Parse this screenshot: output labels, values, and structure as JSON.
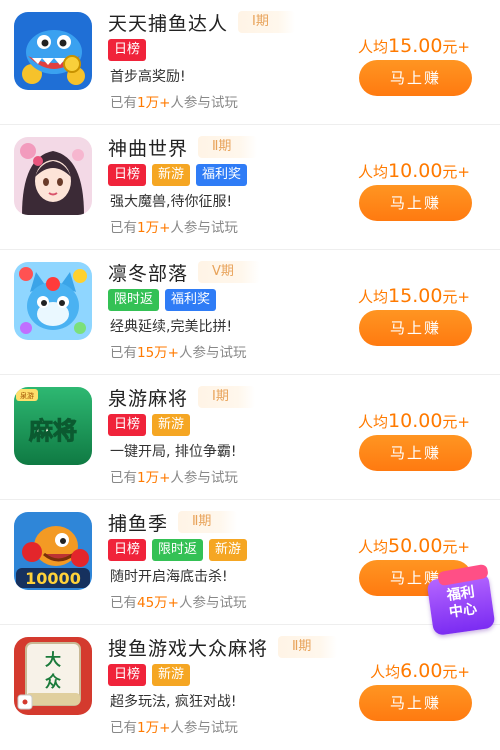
{
  "colors": {
    "accent": "#ff7a00",
    "tag_red": "#f0233a",
    "tag_orange": "#f5a623",
    "tag_blue": "#2f7cf6",
    "tag_green": "#34c155"
  },
  "games": [
    {
      "title": "天天捕鱼达人",
      "period": "Ⅰ期",
      "tags": [
        {
          "text": "日榜",
          "color": "red"
        }
      ],
      "desc": "首步高奖励!",
      "players_prefix": "已有",
      "players_count": "1万+",
      "players_suffix": "人参与试玩",
      "price_prefix": "人均",
      "price_amount": "15.00",
      "price_suffix": "元+",
      "button": "马上赚",
      "icon": "fish-cartoon-icon"
    },
    {
      "title": "神曲世界",
      "period": "Ⅱ期",
      "tags": [
        {
          "text": "日榜",
          "color": "red"
        },
        {
          "text": "新游",
          "color": "orange"
        },
        {
          "text": "福利奖",
          "color": "blue"
        }
      ],
      "desc": "强大魔兽,待你征服!",
      "players_prefix": "已有",
      "players_count": "1万+",
      "players_suffix": "人参与试玩",
      "price_prefix": "人均",
      "price_amount": "10.00",
      "price_suffix": "元+",
      "button": "马上赚",
      "icon": "anime-girl-icon"
    },
    {
      "title": "凛冬部落",
      "period": "Ⅴ期",
      "tags": [
        {
          "text": "限时返",
          "color": "green"
        },
        {
          "text": "福利奖",
          "color": "blue"
        }
      ],
      "desc": "经典延续,完美比拼!",
      "players_prefix": "已有",
      "players_count": "15万+",
      "players_suffix": "人参与试玩",
      "price_prefix": "人均",
      "price_amount": "15.00",
      "price_suffix": "元+",
      "button": "马上赚",
      "icon": "blue-cat-icon"
    },
    {
      "title": "泉游麻将",
      "period": "Ⅰ期",
      "tags": [
        {
          "text": "日榜",
          "color": "red"
        },
        {
          "text": "新游",
          "color": "orange"
        }
      ],
      "desc": "一键开局, 排位争霸!",
      "players_prefix": "已有",
      "players_count": "1万+",
      "players_suffix": "人参与试玩",
      "price_prefix": "人均",
      "price_amount": "10.00",
      "price_suffix": "元+",
      "button": "马上赚",
      "icon": "mahjong-green-icon",
      "icon_text": "麻将",
      "icon_small_text": "泉游"
    },
    {
      "title": "捕鱼季",
      "period": "Ⅱ期",
      "tags": [
        {
          "text": "日榜",
          "color": "red"
        },
        {
          "text": "限时返",
          "color": "green"
        },
        {
          "text": "新游",
          "color": "orange"
        }
      ],
      "desc": "随时开启海底击杀!",
      "players_prefix": "已有",
      "players_count": "45万+",
      "players_suffix": "人参与试玩",
      "price_prefix": "人均",
      "price_amount": "50.00",
      "price_suffix": "元+",
      "button": "马上赚",
      "icon": "fish-boxer-icon",
      "icon_text": "10000"
    },
    {
      "title": "搜鱼游戏大众麻将",
      "period": "Ⅱ期",
      "tags": [
        {
          "text": "日榜",
          "color": "red"
        },
        {
          "text": "新游",
          "color": "orange"
        }
      ],
      "desc": "超多玩法, 疯狂对战!",
      "players_prefix": "已有",
      "players_count": "1万+",
      "players_suffix": "人参与试玩",
      "price_prefix": "人均",
      "price_amount": "6.00",
      "price_suffix": "元+",
      "button": "马上赚",
      "icon": "mahjong-tile-icon",
      "icon_text": "大众"
    }
  ],
  "welfare_badge": {
    "line1": "福利",
    "line2": "中心",
    "icon": "gift-box-icon"
  }
}
